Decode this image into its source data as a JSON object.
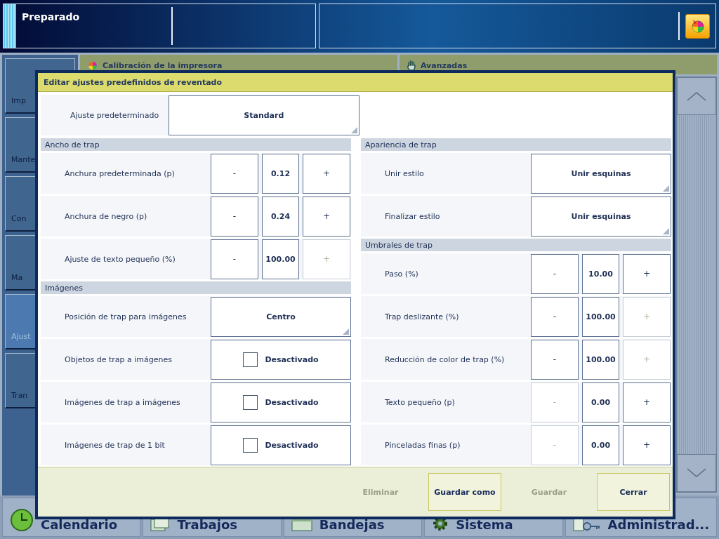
{
  "status_bar": {
    "status": "Preparado"
  },
  "sidebar": {
    "items": [
      {
        "label": "Imp",
        "selected": false
      },
      {
        "label": "Mante",
        "selected": false
      },
      {
        "label": "Con",
        "selected": false
      },
      {
        "label": "Ma",
        "selected": false
      },
      {
        "label": "Ajust",
        "selected": true
      },
      {
        "label": "Tran",
        "selected": false
      }
    ]
  },
  "tabs": [
    {
      "label": "Calibración de la impresora",
      "kind": "wheel"
    },
    {
      "label": "Avanzadas",
      "kind": "hand"
    }
  ],
  "dialog": {
    "title": "Editar ajustes predefinidos de reventado",
    "preset": {
      "label": "Ajuste predeterminado",
      "value": "Standard"
    },
    "columns": [
      [
        {
          "title": "Ancho de trap",
          "rows": [
            {
              "kind": "stepper",
              "label": "Anchura predeterminada (p)",
              "value": "0.12",
              "decrement": {
                "label": "-",
                "disabled": false
              },
              "increment": {
                "label": "+",
                "disabled": false
              }
            },
            {
              "kind": "stepper",
              "label": "Anchura de negro (p)",
              "value": "0.24",
              "decrement": {
                "label": "-",
                "disabled": false
              },
              "increment": {
                "label": "+",
                "disabled": false
              }
            },
            {
              "kind": "stepper",
              "label": "Ajuste de texto pequeño (%)",
              "value": "100.00",
              "decrement": {
                "label": "-",
                "disabled": false
              },
              "increment": {
                "label": "+",
                "disabled": true
              }
            }
          ]
        },
        {
          "title": "Imágenes",
          "rows": [
            {
              "kind": "dropdown",
              "label": "Posición de trap para imágenes",
              "value": "Centro"
            },
            {
              "kind": "checkbox",
              "label": "Objetos de trap a imágenes",
              "value": "Desactivado",
              "checked": false
            },
            {
              "kind": "checkbox",
              "label": "Imágenes de trap a imágenes",
              "value": "Desactivado",
              "checked": false
            },
            {
              "kind": "checkbox",
              "label": "Imágenes de trap de 1 bit",
              "value": "Desactivado",
              "checked": false
            }
          ]
        }
      ],
      [
        {
          "title": "Apariencia de trap",
          "rows": [
            {
              "kind": "dropdown",
              "label": "Unir estilo",
              "value": "Unir esquinas"
            },
            {
              "kind": "dropdown",
              "label": "Finalizar estilo",
              "value": "Unir esquinas"
            }
          ]
        },
        {
          "title": "Umbrales de trap",
          "rows": [
            {
              "kind": "stepper",
              "label": "Paso (%)",
              "value": "10.00",
              "decrement": {
                "label": "-",
                "disabled": false
              },
              "increment": {
                "label": "+",
                "disabled": false
              }
            },
            {
              "kind": "stepper",
              "label": "Trap deslizante (%)",
              "value": "100.00",
              "decrement": {
                "label": "-",
                "disabled": false
              },
              "increment": {
                "label": "+",
                "disabled": true
              }
            },
            {
              "kind": "stepper",
              "label": "Reducción de color de trap (%)",
              "value": "100.00",
              "decrement": {
                "label": "-",
                "disabled": false
              },
              "increment": {
                "label": "+",
                "disabled": true
              }
            },
            {
              "kind": "stepper",
              "label": "Texto pequeño (p)",
              "value": "0.00",
              "decrement": {
                "label": "-",
                "disabled": true
              },
              "increment": {
                "label": "+",
                "disabled": false
              }
            },
            {
              "kind": "stepper",
              "label": "Pinceladas finas (p)",
              "value": "0.00",
              "decrement": {
                "label": "-",
                "disabled": true
              },
              "increment": {
                "label": "+",
                "disabled": false
              }
            }
          ]
        }
      ]
    ],
    "buttons": [
      {
        "label": "Eliminar",
        "disabled": true
      },
      {
        "label": "Guardar como",
        "disabled": false
      },
      {
        "label": "Guardar",
        "disabled": true
      },
      {
        "label": "Cerrar",
        "disabled": false
      }
    ]
  },
  "taskbar": [
    {
      "label": "Calendario",
      "kind": "clock"
    },
    {
      "label": "Trabajos",
      "kind": "jobs"
    },
    {
      "label": "Bandejas",
      "kind": "trays"
    },
    {
      "label": "Sistema",
      "kind": "gear"
    },
    {
      "label": "Administrad...",
      "kind": "keys"
    }
  ]
}
